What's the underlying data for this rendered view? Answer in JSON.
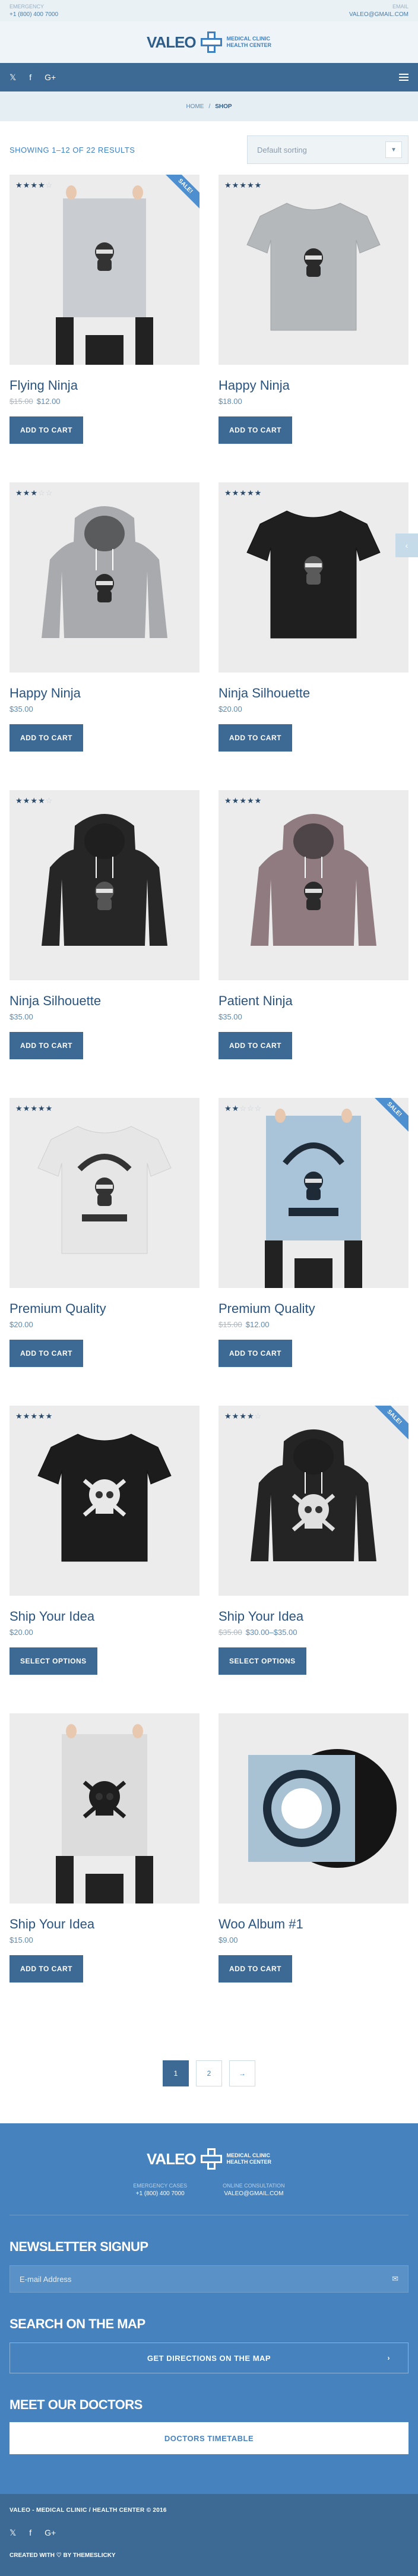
{
  "topbar": {
    "phone_label": "EMERGENCY",
    "phone": "+1 (800) 400 7000",
    "email_label": "EMAIL",
    "email": "VALEO@GMAIL.COM"
  },
  "brand": {
    "name": "VALEO",
    "sub1": "MEDICAL CLINIC",
    "sub2": "HEALTH CENTER"
  },
  "nav": {
    "socials": [
      "𝕏",
      "f",
      "G+"
    ],
    "menu_icon": "hamburger-icon"
  },
  "breadcrumb": {
    "home": "HOME",
    "sep": "/",
    "current": "SHOP"
  },
  "shop": {
    "result_count": "SHOWING 1–12 OF 22 RESULTS",
    "sort_value": "Default sorting",
    "sale_label": "SALE!"
  },
  "products": [
    {
      "name": "Flying Ninja",
      "rating": 4,
      "sale": true,
      "price_old": "$15.00",
      "price": "$12.00",
      "button": "ADD TO CART",
      "art": "poster-ninja"
    },
    {
      "name": "Happy Ninja",
      "rating": 5,
      "sale": false,
      "price_old": "",
      "price": "$18.00",
      "button": "ADD TO CART",
      "art": "tshirt-grey"
    },
    {
      "name": "Happy Ninja",
      "rating": 3,
      "sale": false,
      "price_old": "",
      "price": "$35.00",
      "button": "ADD TO CART",
      "art": "hoodie-grey"
    },
    {
      "name": "Ninja Silhouette",
      "rating": 5,
      "sale": false,
      "price_old": "",
      "price": "$20.00",
      "button": "ADD TO CART",
      "art": "tshirt-black"
    },
    {
      "name": "Ninja Silhouette",
      "rating": 4,
      "sale": false,
      "price_old": "",
      "price": "$35.00",
      "button": "ADD TO CART",
      "art": "hoodie-black"
    },
    {
      "name": "Patient Ninja",
      "rating": 5,
      "sale": false,
      "price_old": "",
      "price": "$35.00",
      "button": "ADD TO CART",
      "art": "hoodie-pink"
    },
    {
      "name": "Premium Quality",
      "rating": 4.5,
      "sale": false,
      "price_old": "",
      "price": "$20.00",
      "button": "ADD TO CART",
      "art": "tshirt-white-logo"
    },
    {
      "name": "Premium Quality",
      "rating": 2,
      "sale": true,
      "price_old": "$15.00",
      "price": "$12.00",
      "button": "ADD TO CART",
      "art": "poster-blue"
    },
    {
      "name": "Ship Your Idea",
      "rating": 4.5,
      "sale": false,
      "price_old": "",
      "price": "$20.00",
      "button": "SELECT OPTIONS",
      "art": "tshirt-black-skull"
    },
    {
      "name": "Ship Your Idea",
      "rating": 4,
      "sale": true,
      "price_old": "$35.00",
      "price": "$30.00–$35.00",
      "button": "SELECT OPTIONS",
      "art": "hoodie-black-skull"
    },
    {
      "name": "Ship Your Idea",
      "rating": 0,
      "sale": false,
      "price_old": "",
      "price": "$15.00",
      "button": "ADD TO CART",
      "art": "poster-skull"
    },
    {
      "name": "Woo Album #1",
      "rating": 0,
      "sale": false,
      "price_old": "",
      "price": "$9.00",
      "button": "ADD TO CART",
      "art": "album"
    }
  ],
  "pagination": {
    "pages": [
      "1",
      "2"
    ],
    "next": "→"
  },
  "footer": {
    "contact_left_label": "EMERGENCY CASES",
    "contact_left": "+1 (800) 400 7000",
    "contact_right_label": "ONLINE CONSULTATION",
    "contact_right": "VALEO@GMAIL.COM",
    "newsletter_title": "NEWSLETTER SIGNUP",
    "newsletter_placeholder": "E-mail Address",
    "map_title": "SEARCH ON THE MAP",
    "map_button": "GET DIRECTIONS ON THE MAP",
    "doctors_title": "MEET OUR DOCTORS",
    "doctors_button": "DOCTORS TIMETABLE"
  },
  "bottombar": {
    "copyright": "VALEO - MEDICAL CLINIC / HEALTH CENTER © 2016",
    "socials": [
      "𝕏",
      "f",
      "G+"
    ],
    "created": "CREATED WITH ♡ BY THEMESLICKY"
  },
  "colors": {
    "brand_blue": "#3d6a94",
    "accent": "#4682bd",
    "sale": "#4d8fcf"
  }
}
